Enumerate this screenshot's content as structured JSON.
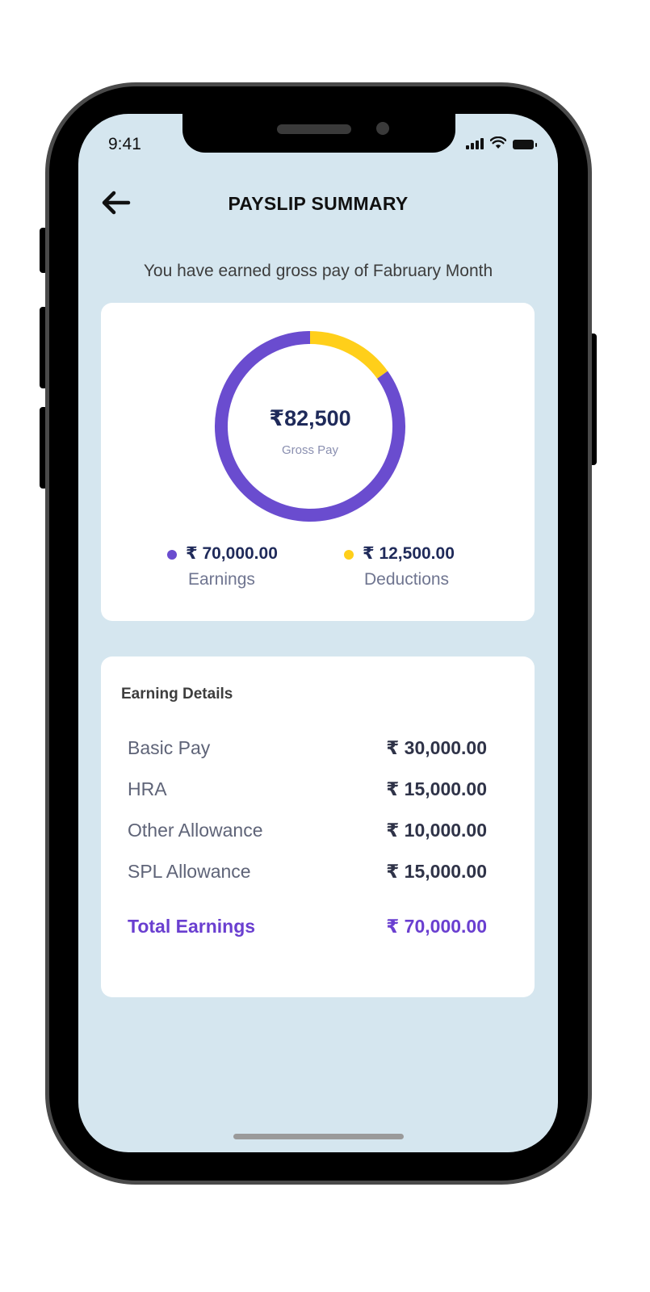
{
  "status_bar": {
    "time": "9:41"
  },
  "header": {
    "title": "PAYSLIP SUMMARY"
  },
  "summary": {
    "subtitle": "You have earned gross pay of Fabruary Month",
    "gross_value": "₹82,500",
    "gross_label": "Gross Pay",
    "earnings_value": "₹ 70,000.00",
    "earnings_label": "Earnings",
    "deductions_value": "₹ 12,500.00",
    "deductions_label": "Deductions"
  },
  "chart_data": {
    "type": "pie",
    "categories": [
      "Earnings",
      "Deductions"
    ],
    "values": [
      70000,
      12500
    ],
    "colors": [
      "#6a4ccf",
      "#ffcf1a"
    ]
  },
  "earning_details": {
    "title": "Earning Details",
    "rows": [
      {
        "label": "Basic Pay",
        "value": "₹ 30,000.00"
      },
      {
        "label": "HRA",
        "value": "₹ 15,000.00"
      },
      {
        "label": "Other Allowance",
        "value": "₹ 10,000.00"
      },
      {
        "label": "SPL Allowance",
        "value": "₹ 15,000.00"
      }
    ],
    "total": {
      "label": "Total Earnings",
      "value": "₹ 70,000.00"
    }
  },
  "colors": {
    "screen_bg": "#d5e6ef",
    "accent_purple": "#6a4ccf",
    "accent_yellow": "#ffcf1a"
  }
}
